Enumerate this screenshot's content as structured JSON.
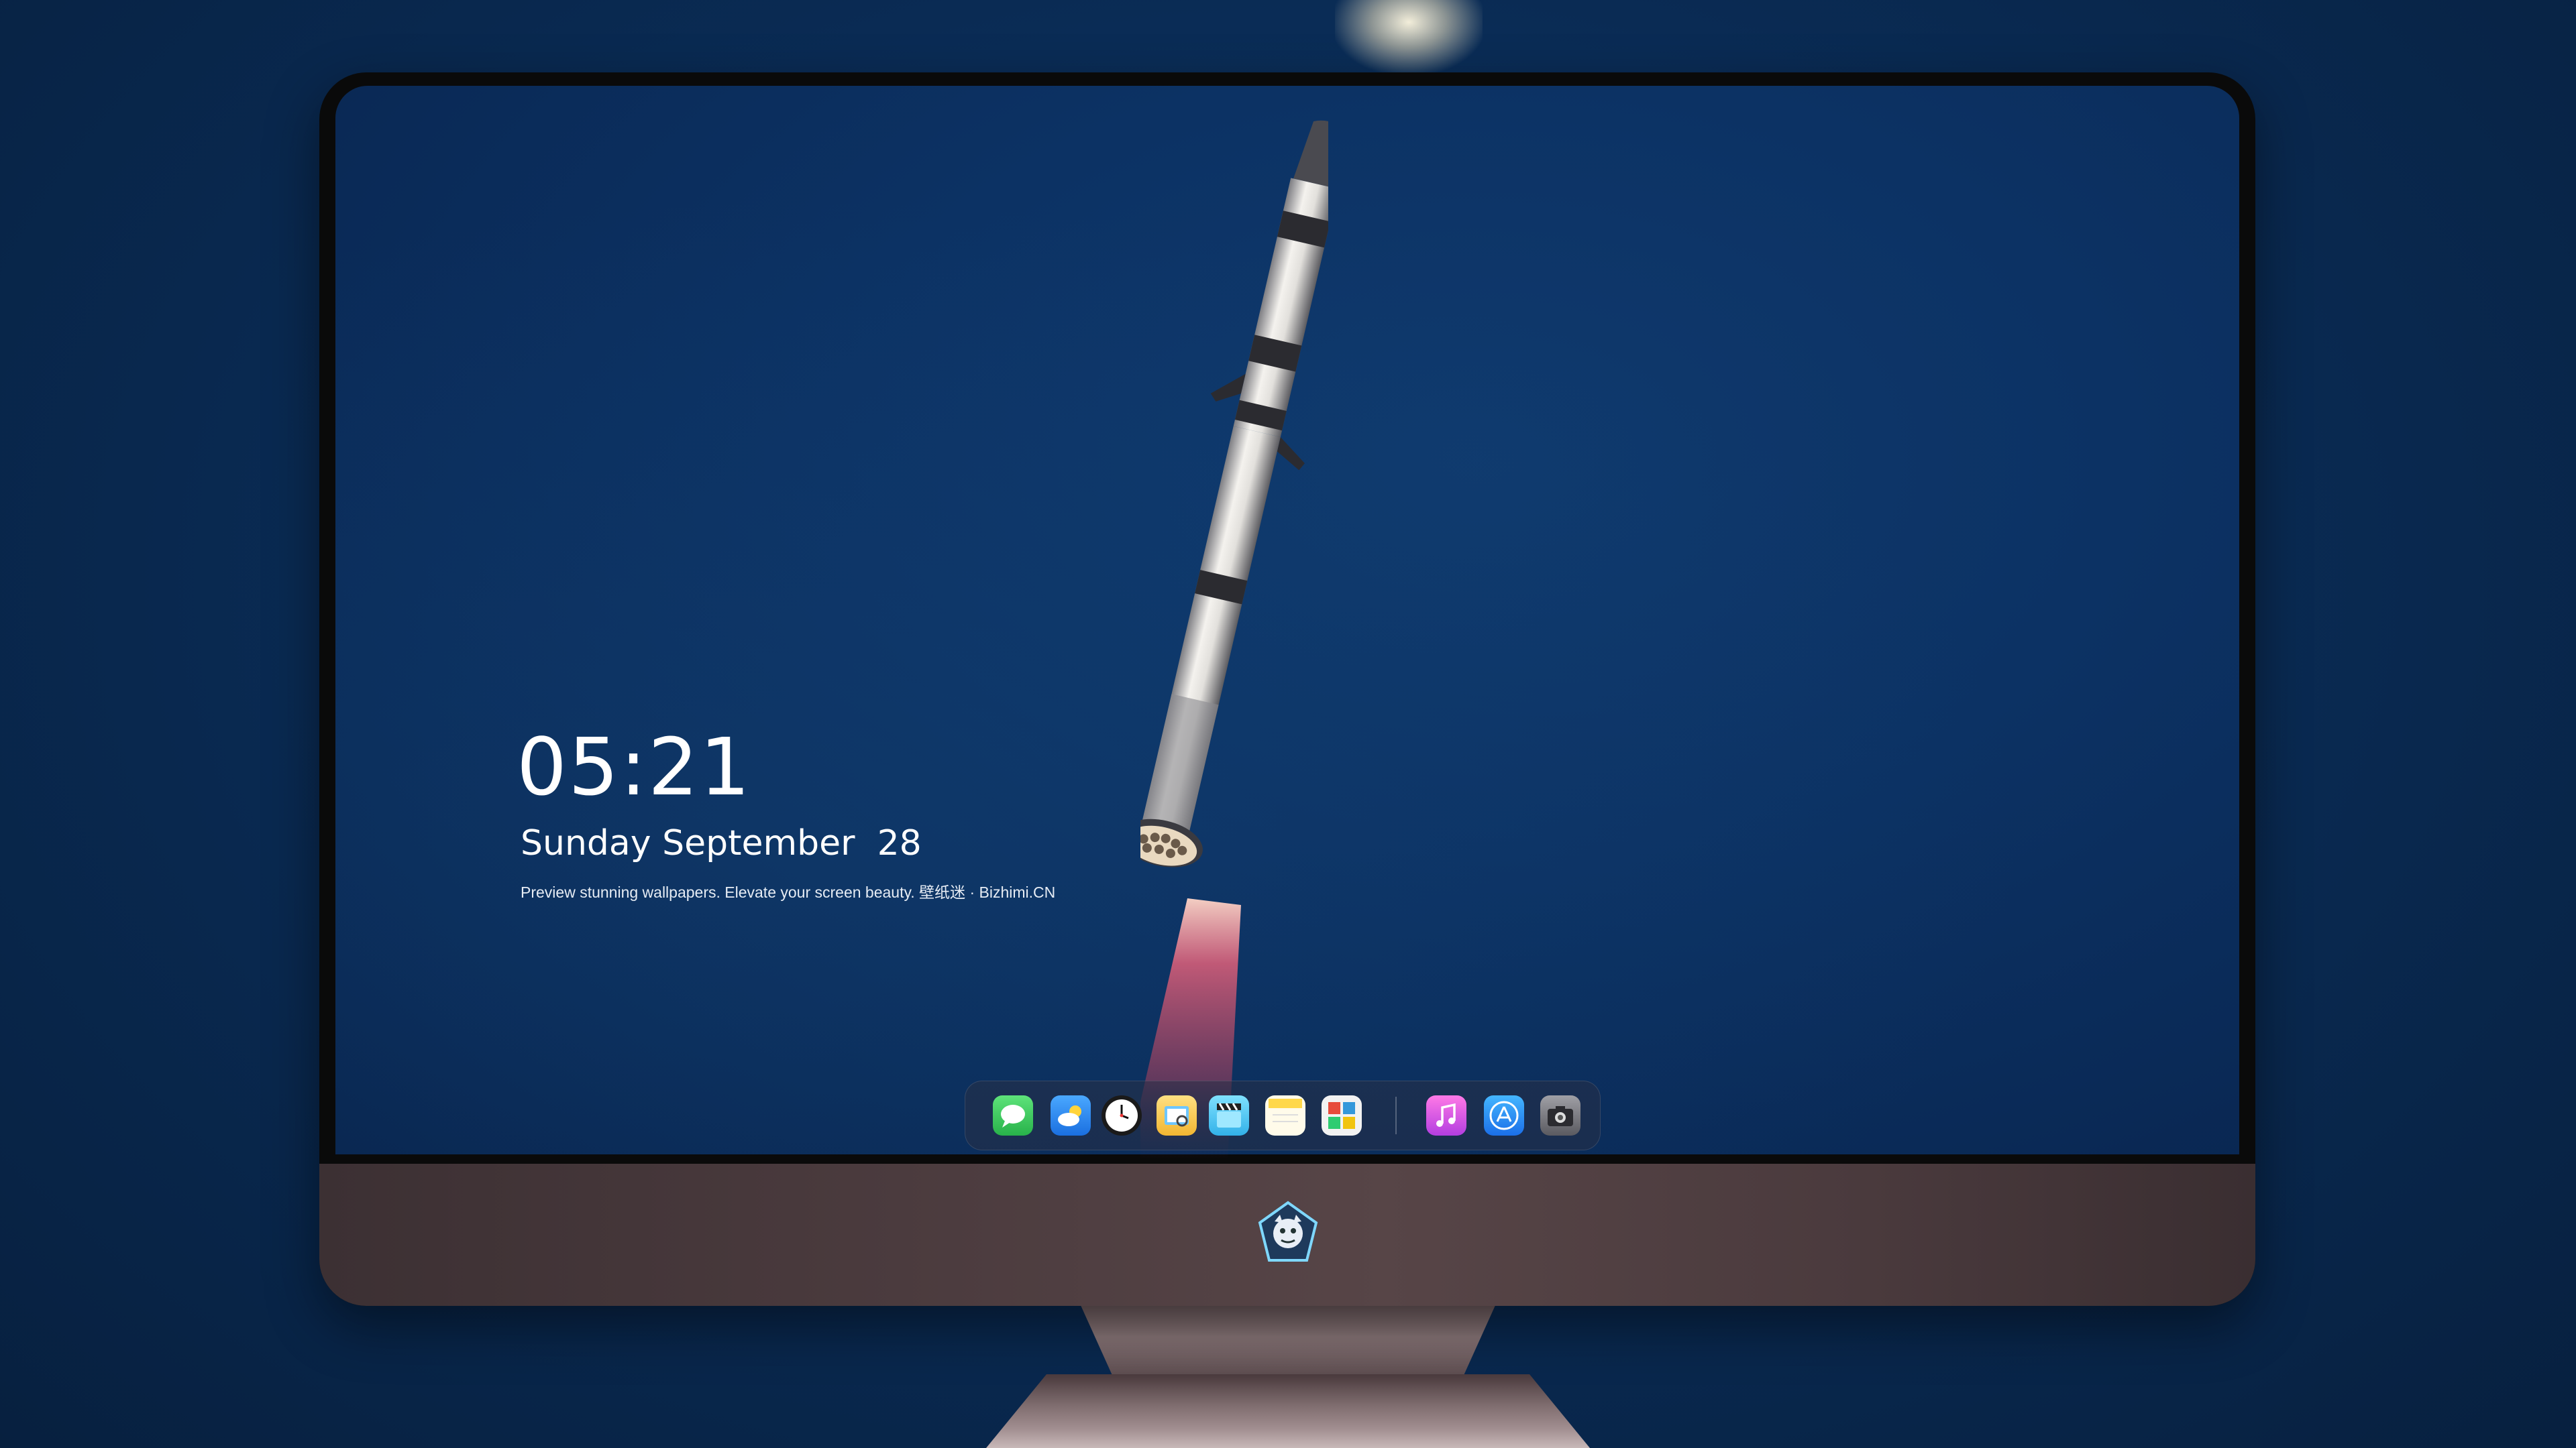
{
  "clock": {
    "time": "05:21",
    "date": "Sunday September  28",
    "tagline": "Preview stunning wallpapers. Elevate your screen beauty. 壁纸迷 · Bizhimi.CN"
  },
  "dock": {
    "apps": [
      {
        "name": "messages-icon",
        "color": "#34c759"
      },
      {
        "name": "weather-icon",
        "color": "#2d8ef0"
      },
      {
        "name": "clock-icon",
        "color": "#ffffff"
      },
      {
        "name": "preview-icon",
        "color": "#f2c94c"
      },
      {
        "name": "clips-icon",
        "color": "#5ac8fa"
      },
      {
        "name": "notes-icon",
        "color": "#ffd84a"
      },
      {
        "name": "photo-booth-icon",
        "color": "#e0e0e0"
      },
      {
        "name": "itunes-icon",
        "color": "#d63bd6"
      },
      {
        "name": "app-store-icon",
        "color": "#1a8cff"
      },
      {
        "name": "screenshot-icon",
        "color": "#8e8e93"
      }
    ]
  },
  "colors": {
    "background": "#0a2c56",
    "screen": "#0c3264",
    "chin": "#4b3b3e",
    "text": "#ffffff"
  }
}
